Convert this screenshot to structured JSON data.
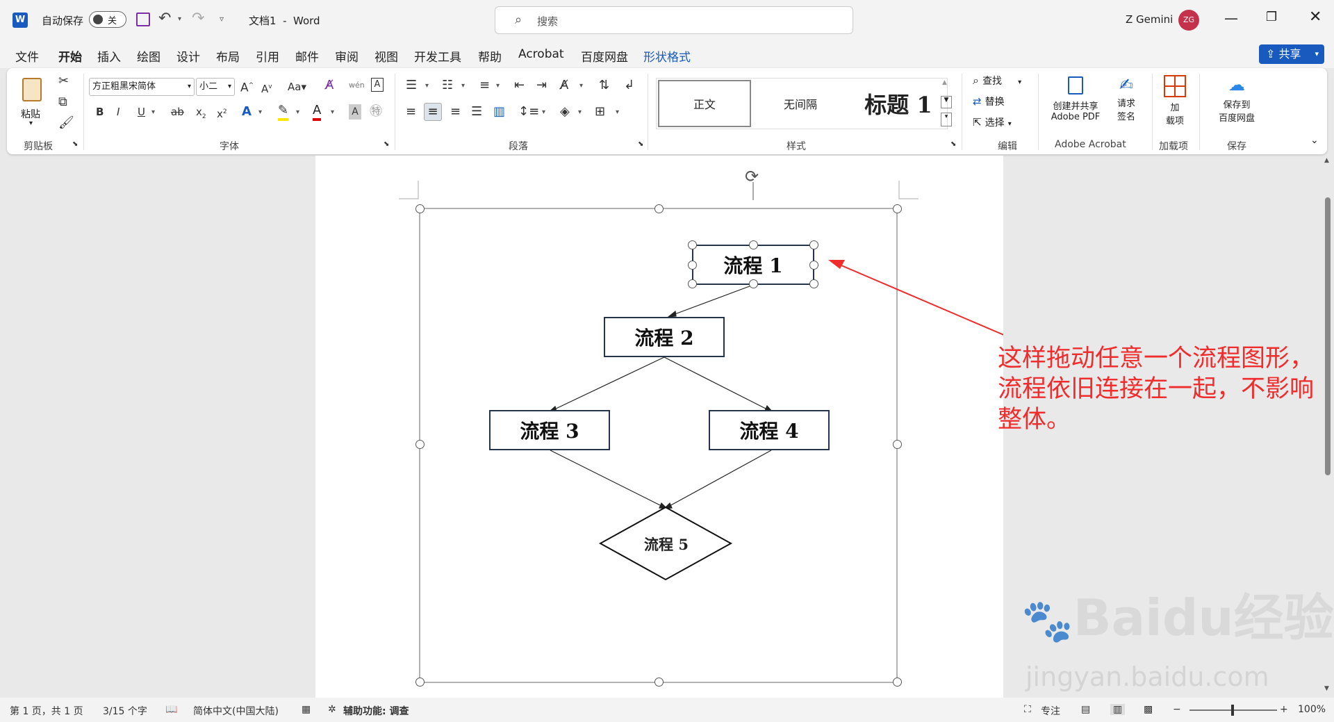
{
  "titlebar": {
    "autosave_label": "自动保存",
    "autosave_state": "关",
    "doc_title": "文档1  -  Word",
    "search_placeholder": "搜索",
    "user_name": "Z Gemini",
    "user_initials": "ZG"
  },
  "tabs": [
    "文件",
    "开始",
    "插入",
    "绘图",
    "设计",
    "布局",
    "引用",
    "邮件",
    "审阅",
    "视图",
    "开发工具",
    "帮助",
    "Acrobat",
    "百度网盘",
    "形状格式"
  ],
  "share_label": "共享",
  "ribbon": {
    "clipboard": {
      "paste": "粘贴",
      "group": "剪贴板"
    },
    "font": {
      "family": "方正粗黑宋简体",
      "size": "小二",
      "group": "字体"
    },
    "paragraph": {
      "group": "段落"
    },
    "styles": {
      "items": [
        "正文",
        "无间隔",
        "标题 1"
      ],
      "group": "样式"
    },
    "editing": {
      "find": "查找",
      "replace": "替换",
      "select": "选择",
      "group": "编辑"
    },
    "acrobat": {
      "create": "创建并共享",
      "create2": "Adobe PDF",
      "sign": "请求",
      "sign2": "签名",
      "group": "Adobe Acrobat"
    },
    "addins": {
      "label": "加",
      "label2": "载项",
      "group": "加载项"
    },
    "save": {
      "label": "保存到",
      "label2": "百度网盘",
      "group": "保存"
    }
  },
  "flow": {
    "p1": "流程 1",
    "p2": "流程 2",
    "p3": "流程 3",
    "p4": "流程 4",
    "p5": "流程 5"
  },
  "annotation": "这样拖动任意一个流程图形，流程依旧连接在一起，不影响整体。",
  "watermark": {
    "brand": "Baidu经验",
    "url": "jingyan.baidu.com"
  },
  "status": {
    "page": "第 1 页，共 1 页",
    "words": "3/15 个字",
    "language": "简体中文(中国大陆)",
    "accessibility": "辅助功能: 调查",
    "focus": "专注",
    "zoom": "100%"
  },
  "colors": {
    "accent": "#185abd",
    "annotation": "#f02c2c",
    "shape_border": "#24344d"
  }
}
